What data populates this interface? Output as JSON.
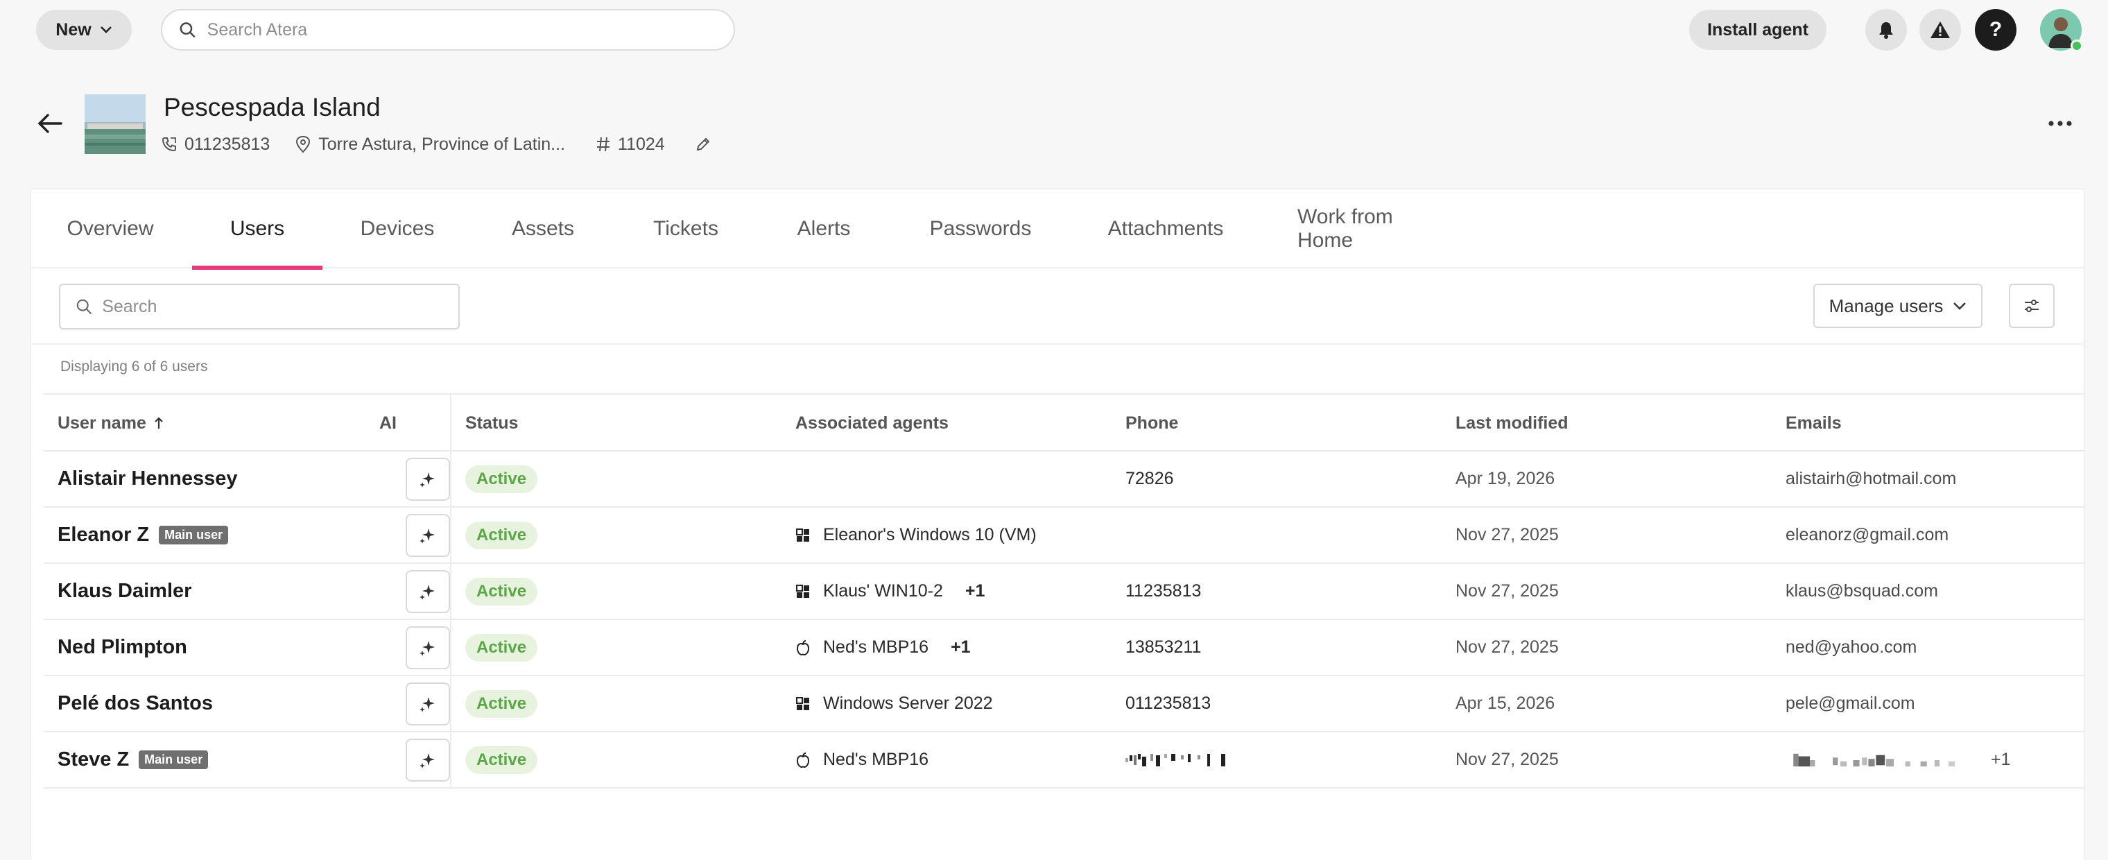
{
  "topbar": {
    "new_label": "New",
    "search_placeholder": "Search Atera",
    "install_label": "Install agent",
    "help_label": "?"
  },
  "site": {
    "title": "Pescespada Island",
    "phone": "011235813",
    "address": "Torre Astura, Province of Latin...",
    "id": "11024"
  },
  "tabs": [
    {
      "label": "Overview"
    },
    {
      "label": "Users",
      "active": true
    },
    {
      "label": "Devices"
    },
    {
      "label": "Assets"
    },
    {
      "label": "Tickets"
    },
    {
      "label": "Alerts"
    },
    {
      "label": "Passwords"
    },
    {
      "label": "Attachments"
    },
    {
      "label": "Work from Home"
    }
  ],
  "toolbar": {
    "search_placeholder": "Search",
    "manage_label": "Manage users"
  },
  "count_text": "Displaying 6 of 6 users",
  "table": {
    "columns": {
      "name": "User name",
      "ai": "AI",
      "status": "Status",
      "agents": "Associated agents",
      "phone": "Phone",
      "modified": "Last modified",
      "emails": "Emails"
    },
    "rows": [
      {
        "name": "Alistair Hennessey",
        "badge": "",
        "status": "Active",
        "agent": "",
        "agent_icon": "",
        "agent_extra": "",
        "phone": "72826",
        "modified": "Apr 19, 2026",
        "email": "alistairh@hotmail.com",
        "email_extra": ""
      },
      {
        "name": "Eleanor Z",
        "badge": "Main user",
        "status": "Active",
        "agent": "Eleanor's Windows 10 (VM)",
        "agent_icon": "windows-icon",
        "agent_extra": "",
        "phone": "",
        "modified": "Nov 27, 2025",
        "email": "eleanorz@gmail.com",
        "email_extra": ""
      },
      {
        "name": "Klaus Daimler",
        "badge": "",
        "status": "Active",
        "agent": "Klaus' WIN10-2",
        "agent_icon": "windows-icon",
        "agent_extra": "+1",
        "phone": "11235813",
        "modified": "Nov 27, 2025",
        "email": "klaus@bsquad.com",
        "email_extra": ""
      },
      {
        "name": "Ned Plimpton",
        "badge": "",
        "status": "Active",
        "agent": "Ned's MBP16",
        "agent_icon": "apple-icon",
        "agent_extra": "+1",
        "phone": "13853211",
        "modified": "Nov 27, 2025",
        "email": "ned@yahoo.com",
        "email_extra": ""
      },
      {
        "name": "Pelé dos Santos",
        "badge": "",
        "status": "Active",
        "agent": "Windows Server 2022",
        "agent_icon": "windows-icon",
        "agent_extra": "",
        "phone": "011235813",
        "modified": "Apr 15, 2026",
        "email": "pele@gmail.com",
        "email_extra": ""
      },
      {
        "name": "Steve Z",
        "badge": "Main user",
        "status": "Active",
        "agent": "Ned's MBP16",
        "agent_icon": "apple-icon",
        "agent_extra": "",
        "phone": "",
        "modified": "Nov 27, 2025",
        "email": "",
        "email_extra": "+1"
      }
    ]
  },
  "colors": {
    "accent": "#e63a79",
    "status_bg": "#e7f3df",
    "status_text": "#5ba646",
    "badge_bg": "#6f6f6f"
  }
}
